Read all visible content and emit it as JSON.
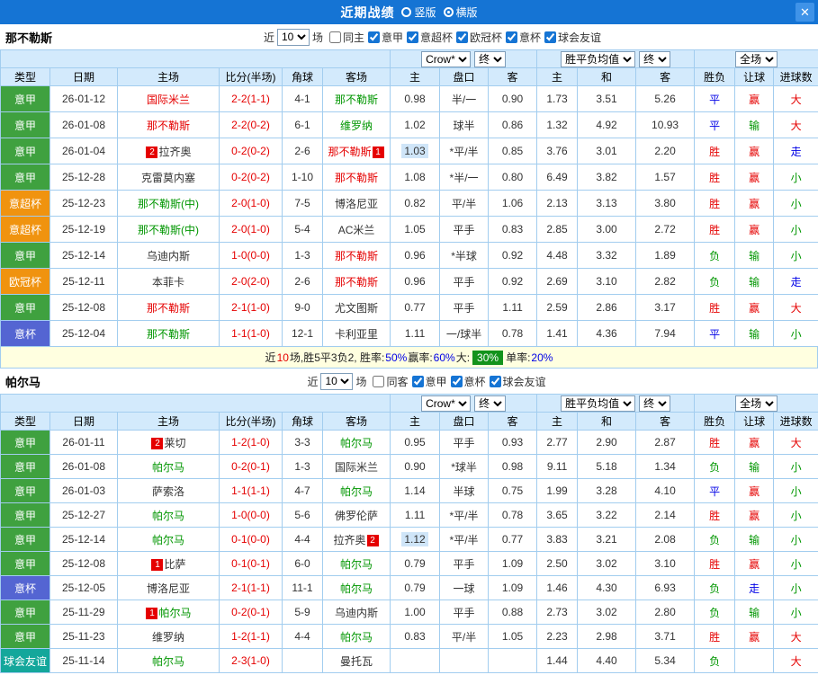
{
  "topbar": {
    "title": "近期战绩",
    "radio_vertical": "竖版",
    "radio_horizontal": "横版",
    "selected": "横版",
    "close_icon": "✕"
  },
  "colors": {
    "league": {
      "意甲": "#3fa13f",
      "意超杯": "#f0930f",
      "欧冠杯": "#f0930f",
      "意杯": "#5465d2",
      "球会友谊": "#14a79b"
    },
    "red": "#e50000",
    "green": "#009600",
    "blue": "#0000e6",
    "black": "#333333",
    "highlight": "#cfe5f8"
  },
  "table_headers": [
    "类型",
    "日期",
    "主场",
    "比分(半场)",
    "角球",
    "客场",
    "主",
    "盘口",
    "客",
    "主",
    "和",
    "客",
    "胜负",
    "让球",
    "进球数"
  ],
  "sections": [
    {
      "team": "那不勒斯",
      "near_label": "近",
      "near_value": "10",
      "games_label": "场",
      "checkboxes": [
        {
          "label": "同主",
          "checked": false
        },
        {
          "label": "意甲",
          "checked": true
        },
        {
          "label": "意超杯",
          "checked": true
        },
        {
          "label": "欧冠杯",
          "checked": true
        },
        {
          "label": "意杯",
          "checked": true
        },
        {
          "label": "球会友谊",
          "checked": true
        }
      ],
      "dropdowns": {
        "odds_source": "Crow*",
        "final1": "终",
        "europe": "胜平负均值",
        "final2": "终",
        "scope": "全场"
      },
      "rows": [
        {
          "league": "意甲",
          "date": "26-01-12",
          "home": {
            "name": "国际米兰",
            "color": "red"
          },
          "score": "2-2(1-1)",
          "corner": "4-1",
          "away": {
            "name": "那不勒斯",
            "color": "green"
          },
          "asian": [
            "0.98",
            "半/一",
            "0.90"
          ],
          "euro": [
            "1.73",
            "3.51",
            "5.26"
          ],
          "result": {
            "text": "平",
            "color": "blue"
          },
          "handicap": {
            "text": "赢",
            "color": "red"
          },
          "goals": {
            "text": "大",
            "color": "red"
          }
        },
        {
          "league": "意甲",
          "date": "26-01-08",
          "home": {
            "name": "那不勒斯",
            "color": "red"
          },
          "score": "2-2(0-2)",
          "corner": "6-1",
          "away": {
            "name": "维罗纳",
            "color": "green"
          },
          "asian": [
            "1.02",
            "球半",
            "0.86"
          ],
          "euro": [
            "1.32",
            "4.92",
            "10.93"
          ],
          "result": {
            "text": "平",
            "color": "blue"
          },
          "handicap": {
            "text": "输",
            "color": "green"
          },
          "goals": {
            "text": "大",
            "color": "red"
          }
        },
        {
          "league": "意甲",
          "date": "26-01-04",
          "home": {
            "name": "拉齐奥",
            "color": "black",
            "badge_before": "2"
          },
          "score": "0-2(0-2)",
          "corner": "2-6",
          "away": {
            "name": "那不勒斯",
            "color": "red",
            "badge_after": "1"
          },
          "asian": [
            "1.03",
            "*平/半",
            "0.85"
          ],
          "asian_hl": true,
          "euro": [
            "3.76",
            "3.01",
            "2.20"
          ],
          "result": {
            "text": "胜",
            "color": "red"
          },
          "handicap": {
            "text": "赢",
            "color": "red"
          },
          "goals": {
            "text": "走",
            "color": "blue"
          }
        },
        {
          "league": "意甲",
          "date": "25-12-28",
          "home": {
            "name": "克雷莫内塞",
            "color": "black"
          },
          "score": "0-2(0-2)",
          "corner": "1-10",
          "away": {
            "name": "那不勒斯",
            "color": "red"
          },
          "asian": [
            "1.08",
            "*半/一",
            "0.80"
          ],
          "euro": [
            "6.49",
            "3.82",
            "1.57"
          ],
          "result": {
            "text": "胜",
            "color": "red"
          },
          "handicap": {
            "text": "赢",
            "color": "red"
          },
          "goals": {
            "text": "小",
            "color": "green"
          }
        },
        {
          "league": "意超杯",
          "date": "25-12-23",
          "home": {
            "name": "那不勒斯(中)",
            "color": "green"
          },
          "score": "2-0(1-0)",
          "corner": "7-5",
          "away": {
            "name": "博洛尼亚",
            "color": "black"
          },
          "asian": [
            "0.82",
            "平/半",
            "1.06"
          ],
          "euro": [
            "2.13",
            "3.13",
            "3.80"
          ],
          "result": {
            "text": "胜",
            "color": "red"
          },
          "handicap": {
            "text": "赢",
            "color": "red"
          },
          "goals": {
            "text": "小",
            "color": "green"
          }
        },
        {
          "league": "意超杯",
          "date": "25-12-19",
          "home": {
            "name": "那不勒斯(中)",
            "color": "green"
          },
          "score": "2-0(1-0)",
          "corner": "5-4",
          "away": {
            "name": "AC米兰",
            "color": "black"
          },
          "asian": [
            "1.05",
            "平手",
            "0.83"
          ],
          "euro": [
            "2.85",
            "3.00",
            "2.72"
          ],
          "result": {
            "text": "胜",
            "color": "red"
          },
          "handicap": {
            "text": "赢",
            "color": "red"
          },
          "goals": {
            "text": "小",
            "color": "green"
          }
        },
        {
          "league": "意甲",
          "date": "25-12-14",
          "home": {
            "name": "乌迪内斯",
            "color": "black"
          },
          "score": "1-0(0-0)",
          "corner": "1-3",
          "away": {
            "name": "那不勒斯",
            "color": "red"
          },
          "asian": [
            "0.96",
            "*半球",
            "0.92"
          ],
          "euro": [
            "4.48",
            "3.32",
            "1.89"
          ],
          "result": {
            "text": "负",
            "color": "green"
          },
          "handicap": {
            "text": "输",
            "color": "green"
          },
          "goals": {
            "text": "小",
            "color": "green"
          }
        },
        {
          "league": "欧冠杯",
          "date": "25-12-11",
          "home": {
            "name": "本菲卡",
            "color": "black"
          },
          "score": "2-0(2-0)",
          "corner": "2-6",
          "away": {
            "name": "那不勒斯",
            "color": "red"
          },
          "asian": [
            "0.96",
            "平手",
            "0.92"
          ],
          "euro": [
            "2.69",
            "3.10",
            "2.82"
          ],
          "result": {
            "text": "负",
            "color": "green"
          },
          "handicap": {
            "text": "输",
            "color": "green"
          },
          "goals": {
            "text": "走",
            "color": "blue"
          }
        },
        {
          "league": "意甲",
          "date": "25-12-08",
          "home": {
            "name": "那不勒斯",
            "color": "red"
          },
          "score": "2-1(1-0)",
          "corner": "9-0",
          "away": {
            "name": "尤文图斯",
            "color": "black"
          },
          "asian": [
            "0.77",
            "平手",
            "1.11"
          ],
          "euro": [
            "2.59",
            "2.86",
            "3.17"
          ],
          "result": {
            "text": "胜",
            "color": "red"
          },
          "handicap": {
            "text": "赢",
            "color": "red"
          },
          "goals": {
            "text": "大",
            "color": "red"
          }
        },
        {
          "league": "意杯",
          "date": "25-12-04",
          "home": {
            "name": "那不勒斯",
            "color": "green"
          },
          "score": "1-1(1-0)",
          "corner": "12-1",
          "away": {
            "name": "卡利亚里",
            "color": "black"
          },
          "asian": [
            "1.11",
            "一/球半",
            "0.78"
          ],
          "euro": [
            "1.41",
            "4.36",
            "7.94"
          ],
          "result": {
            "text": "平",
            "color": "blue"
          },
          "handicap": {
            "text": "输",
            "color": "green"
          },
          "goals": {
            "text": "小",
            "color": "green"
          }
        }
      ],
      "summary": [
        {
          "text": "近"
        },
        {
          "text": "10",
          "color": "red"
        },
        {
          "text": "场,胜5平3负2, 胜率:"
        },
        {
          "text": "50%",
          "color": "blue"
        },
        {
          "text": " 赢率:"
        },
        {
          "text": "60%",
          "color": "blue"
        },
        {
          "text": " 大: "
        },
        {
          "text": "30%",
          "badge": true
        },
        {
          "text": " 单率:"
        },
        {
          "text": "20%",
          "color": "blue"
        }
      ]
    },
    {
      "team": "帕尔马",
      "near_label": "近",
      "near_value": "10",
      "games_label": "场",
      "checkboxes": [
        {
          "label": "同客",
          "checked": false
        },
        {
          "label": "意甲",
          "checked": true
        },
        {
          "label": "意杯",
          "checked": true
        },
        {
          "label": "球会友谊",
          "checked": true
        }
      ],
      "dropdowns": {
        "odds_source": "Crow*",
        "final1": "终",
        "europe": "胜平负均值",
        "final2": "终",
        "scope": "全场"
      },
      "rows": [
        {
          "league": "意甲",
          "date": "26-01-11",
          "home": {
            "name": "莱切",
            "color": "black",
            "badge_before": "2"
          },
          "score": "1-2(1-0)",
          "corner": "3-3",
          "away": {
            "name": "帕尔马",
            "color": "green"
          },
          "asian": [
            "0.95",
            "平手",
            "0.93"
          ],
          "euro": [
            "2.77",
            "2.90",
            "2.87"
          ],
          "result": {
            "text": "胜",
            "color": "red"
          },
          "handicap": {
            "text": "赢",
            "color": "red"
          },
          "goals": {
            "text": "大",
            "color": "red"
          }
        },
        {
          "league": "意甲",
          "date": "26-01-08",
          "home": {
            "name": "帕尔马",
            "color": "green"
          },
          "score": "0-2(0-1)",
          "corner": "1-3",
          "away": {
            "name": "国际米兰",
            "color": "black"
          },
          "asian": [
            "0.90",
            "*球半",
            "0.98"
          ],
          "euro": [
            "9.11",
            "5.18",
            "1.34"
          ],
          "result": {
            "text": "负",
            "color": "green"
          },
          "handicap": {
            "text": "输",
            "color": "green"
          },
          "goals": {
            "text": "小",
            "color": "green"
          }
        },
        {
          "league": "意甲",
          "date": "26-01-03",
          "home": {
            "name": "萨索洛",
            "color": "black"
          },
          "score": "1-1(1-1)",
          "corner": "4-7",
          "away": {
            "name": "帕尔马",
            "color": "green"
          },
          "asian": [
            "1.14",
            "半球",
            "0.75"
          ],
          "euro": [
            "1.99",
            "3.28",
            "4.10"
          ],
          "result": {
            "text": "平",
            "color": "blue"
          },
          "handicap": {
            "text": "赢",
            "color": "red"
          },
          "goals": {
            "text": "小",
            "color": "green"
          }
        },
        {
          "league": "意甲",
          "date": "25-12-27",
          "home": {
            "name": "帕尔马",
            "color": "green"
          },
          "score": "1-0(0-0)",
          "corner": "5-6",
          "away": {
            "name": "佛罗伦萨",
            "color": "black"
          },
          "asian": [
            "1.11",
            "*平/半",
            "0.78"
          ],
          "euro": [
            "3.65",
            "3.22",
            "2.14"
          ],
          "result": {
            "text": "胜",
            "color": "red"
          },
          "handicap": {
            "text": "赢",
            "color": "red"
          },
          "goals": {
            "text": "小",
            "color": "green"
          }
        },
        {
          "league": "意甲",
          "date": "25-12-14",
          "home": {
            "name": "帕尔马",
            "color": "green"
          },
          "score": "0-1(0-0)",
          "corner": "4-4",
          "away": {
            "name": "拉齐奥",
            "color": "black",
            "badge_after": "2"
          },
          "asian": [
            "1.12",
            "*平/半",
            "0.77"
          ],
          "asian_hl": true,
          "euro": [
            "3.83",
            "3.21",
            "2.08"
          ],
          "result": {
            "text": "负",
            "color": "green"
          },
          "handicap": {
            "text": "输",
            "color": "green"
          },
          "goals": {
            "text": "小",
            "color": "green"
          }
        },
        {
          "league": "意甲",
          "date": "25-12-08",
          "home": {
            "name": "比萨",
            "color": "black",
            "badge_before": "1"
          },
          "score": "0-1(0-1)",
          "corner": "6-0",
          "away": {
            "name": "帕尔马",
            "color": "green"
          },
          "asian": [
            "0.79",
            "平手",
            "1.09"
          ],
          "euro": [
            "2.50",
            "3.02",
            "3.10"
          ],
          "result": {
            "text": "胜",
            "color": "red"
          },
          "handicap": {
            "text": "赢",
            "color": "red"
          },
          "goals": {
            "text": "小",
            "color": "green"
          }
        },
        {
          "league": "意杯",
          "date": "25-12-05",
          "home": {
            "name": "博洛尼亚",
            "color": "black"
          },
          "score": "2-1(1-1)",
          "corner": "11-1",
          "away": {
            "name": "帕尔马",
            "color": "green"
          },
          "asian": [
            "0.79",
            "一球",
            "1.09"
          ],
          "euro": [
            "1.46",
            "4.30",
            "6.93"
          ],
          "result": {
            "text": "负",
            "color": "green"
          },
          "handicap": {
            "text": "走",
            "color": "blue"
          },
          "goals": {
            "text": "小",
            "color": "green"
          }
        },
        {
          "league": "意甲",
          "date": "25-11-29",
          "home": {
            "name": "帕尔马",
            "color": "green",
            "badge_before": "1"
          },
          "score": "0-2(0-1)",
          "corner": "5-9",
          "away": {
            "name": "乌迪内斯",
            "color": "black"
          },
          "asian": [
            "1.00",
            "平手",
            "0.88"
          ],
          "euro": [
            "2.73",
            "3.02",
            "2.80"
          ],
          "result": {
            "text": "负",
            "color": "green"
          },
          "handicap": {
            "text": "输",
            "color": "green"
          },
          "goals": {
            "text": "小",
            "color": "green"
          }
        },
        {
          "league": "意甲",
          "date": "25-11-23",
          "home": {
            "name": "维罗纳",
            "color": "black"
          },
          "score": "1-2(1-1)",
          "corner": "4-4",
          "away": {
            "name": "帕尔马",
            "color": "green"
          },
          "asian": [
            "0.83",
            "平/半",
            "1.05"
          ],
          "euro": [
            "2.23",
            "2.98",
            "3.71"
          ],
          "result": {
            "text": "胜",
            "color": "red"
          },
          "handicap": {
            "text": "赢",
            "color": "red"
          },
          "goals": {
            "text": "大",
            "color": "red"
          }
        },
        {
          "league": "球会友谊",
          "date": "25-11-14",
          "home": {
            "name": "帕尔马",
            "color": "green"
          },
          "score": "2-3(1-0)",
          "corner": "",
          "away": {
            "name": "曼托瓦",
            "color": "black"
          },
          "asian": [
            "",
            "",
            ""
          ],
          "euro": [
            "1.44",
            "4.40",
            "5.34"
          ],
          "result": {
            "text": "负",
            "color": "green"
          },
          "handicap": {
            "text": ""
          },
          "goals": {
            "text": "大",
            "color": "red"
          }
        }
      ]
    }
  ]
}
